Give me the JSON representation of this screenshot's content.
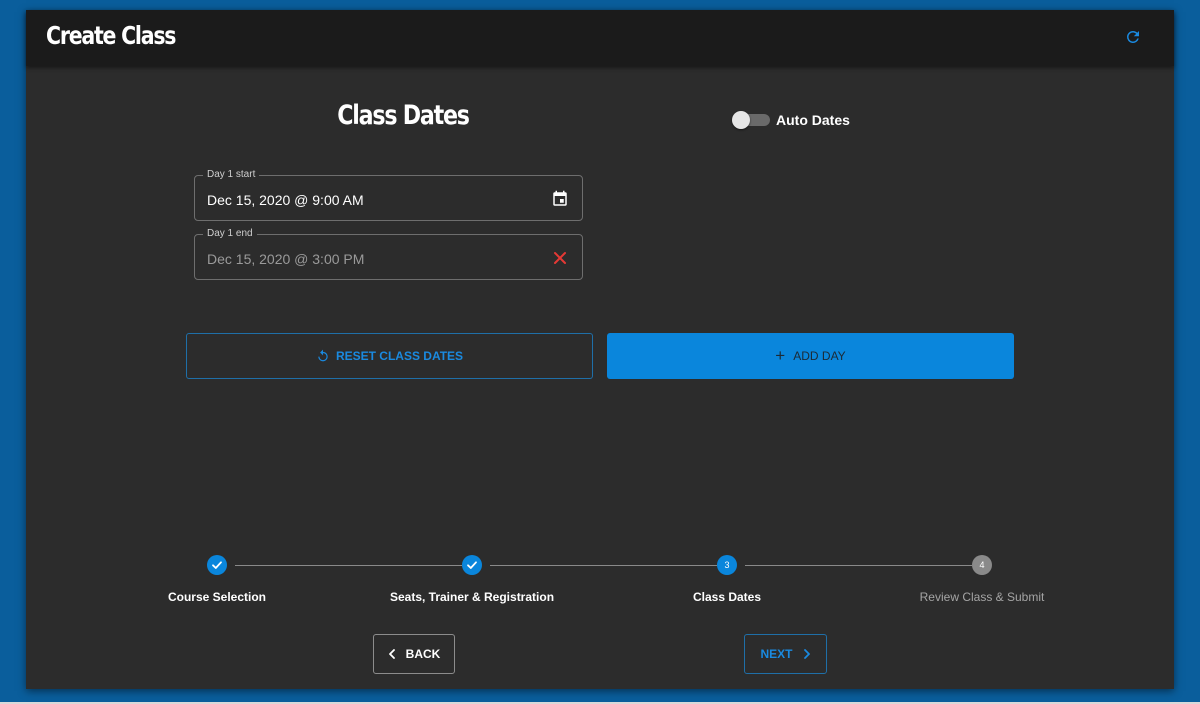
{
  "header": {
    "title": "Create Class",
    "refresh_icon": "refresh-icon"
  },
  "section": {
    "title": "Class Dates",
    "auto_dates": {
      "label": "Auto Dates",
      "enabled": false
    }
  },
  "fields": [
    {
      "label": "Day 1 start",
      "value": "Dec 15, 2020 @ 9:00 AM",
      "icon": "calendar-icon"
    },
    {
      "label": "Day 1 end",
      "value": "Dec 15, 2020 @ 3:00 PM",
      "icon": "clear-icon"
    }
  ],
  "actions": {
    "reset_label": "RESET CLASS DATES",
    "add_day_label": "ADD DAY"
  },
  "stepper": {
    "steps": [
      {
        "number": "1",
        "label": "Course Selection",
        "state": "completed"
      },
      {
        "number": "2",
        "label": "Seats, Trainer & Registration",
        "state": "completed"
      },
      {
        "number": "3",
        "label": "Class Dates",
        "state": "active"
      },
      {
        "number": "4",
        "label": "Review Class & Submit",
        "state": "pending"
      }
    ]
  },
  "navigation": {
    "back_label": "BACK",
    "next_label": "NEXT"
  },
  "colors": {
    "accent": "#0a86dc",
    "background": "#2c2c2c",
    "app_background": "#0a5e9c",
    "error": "#e53935"
  }
}
